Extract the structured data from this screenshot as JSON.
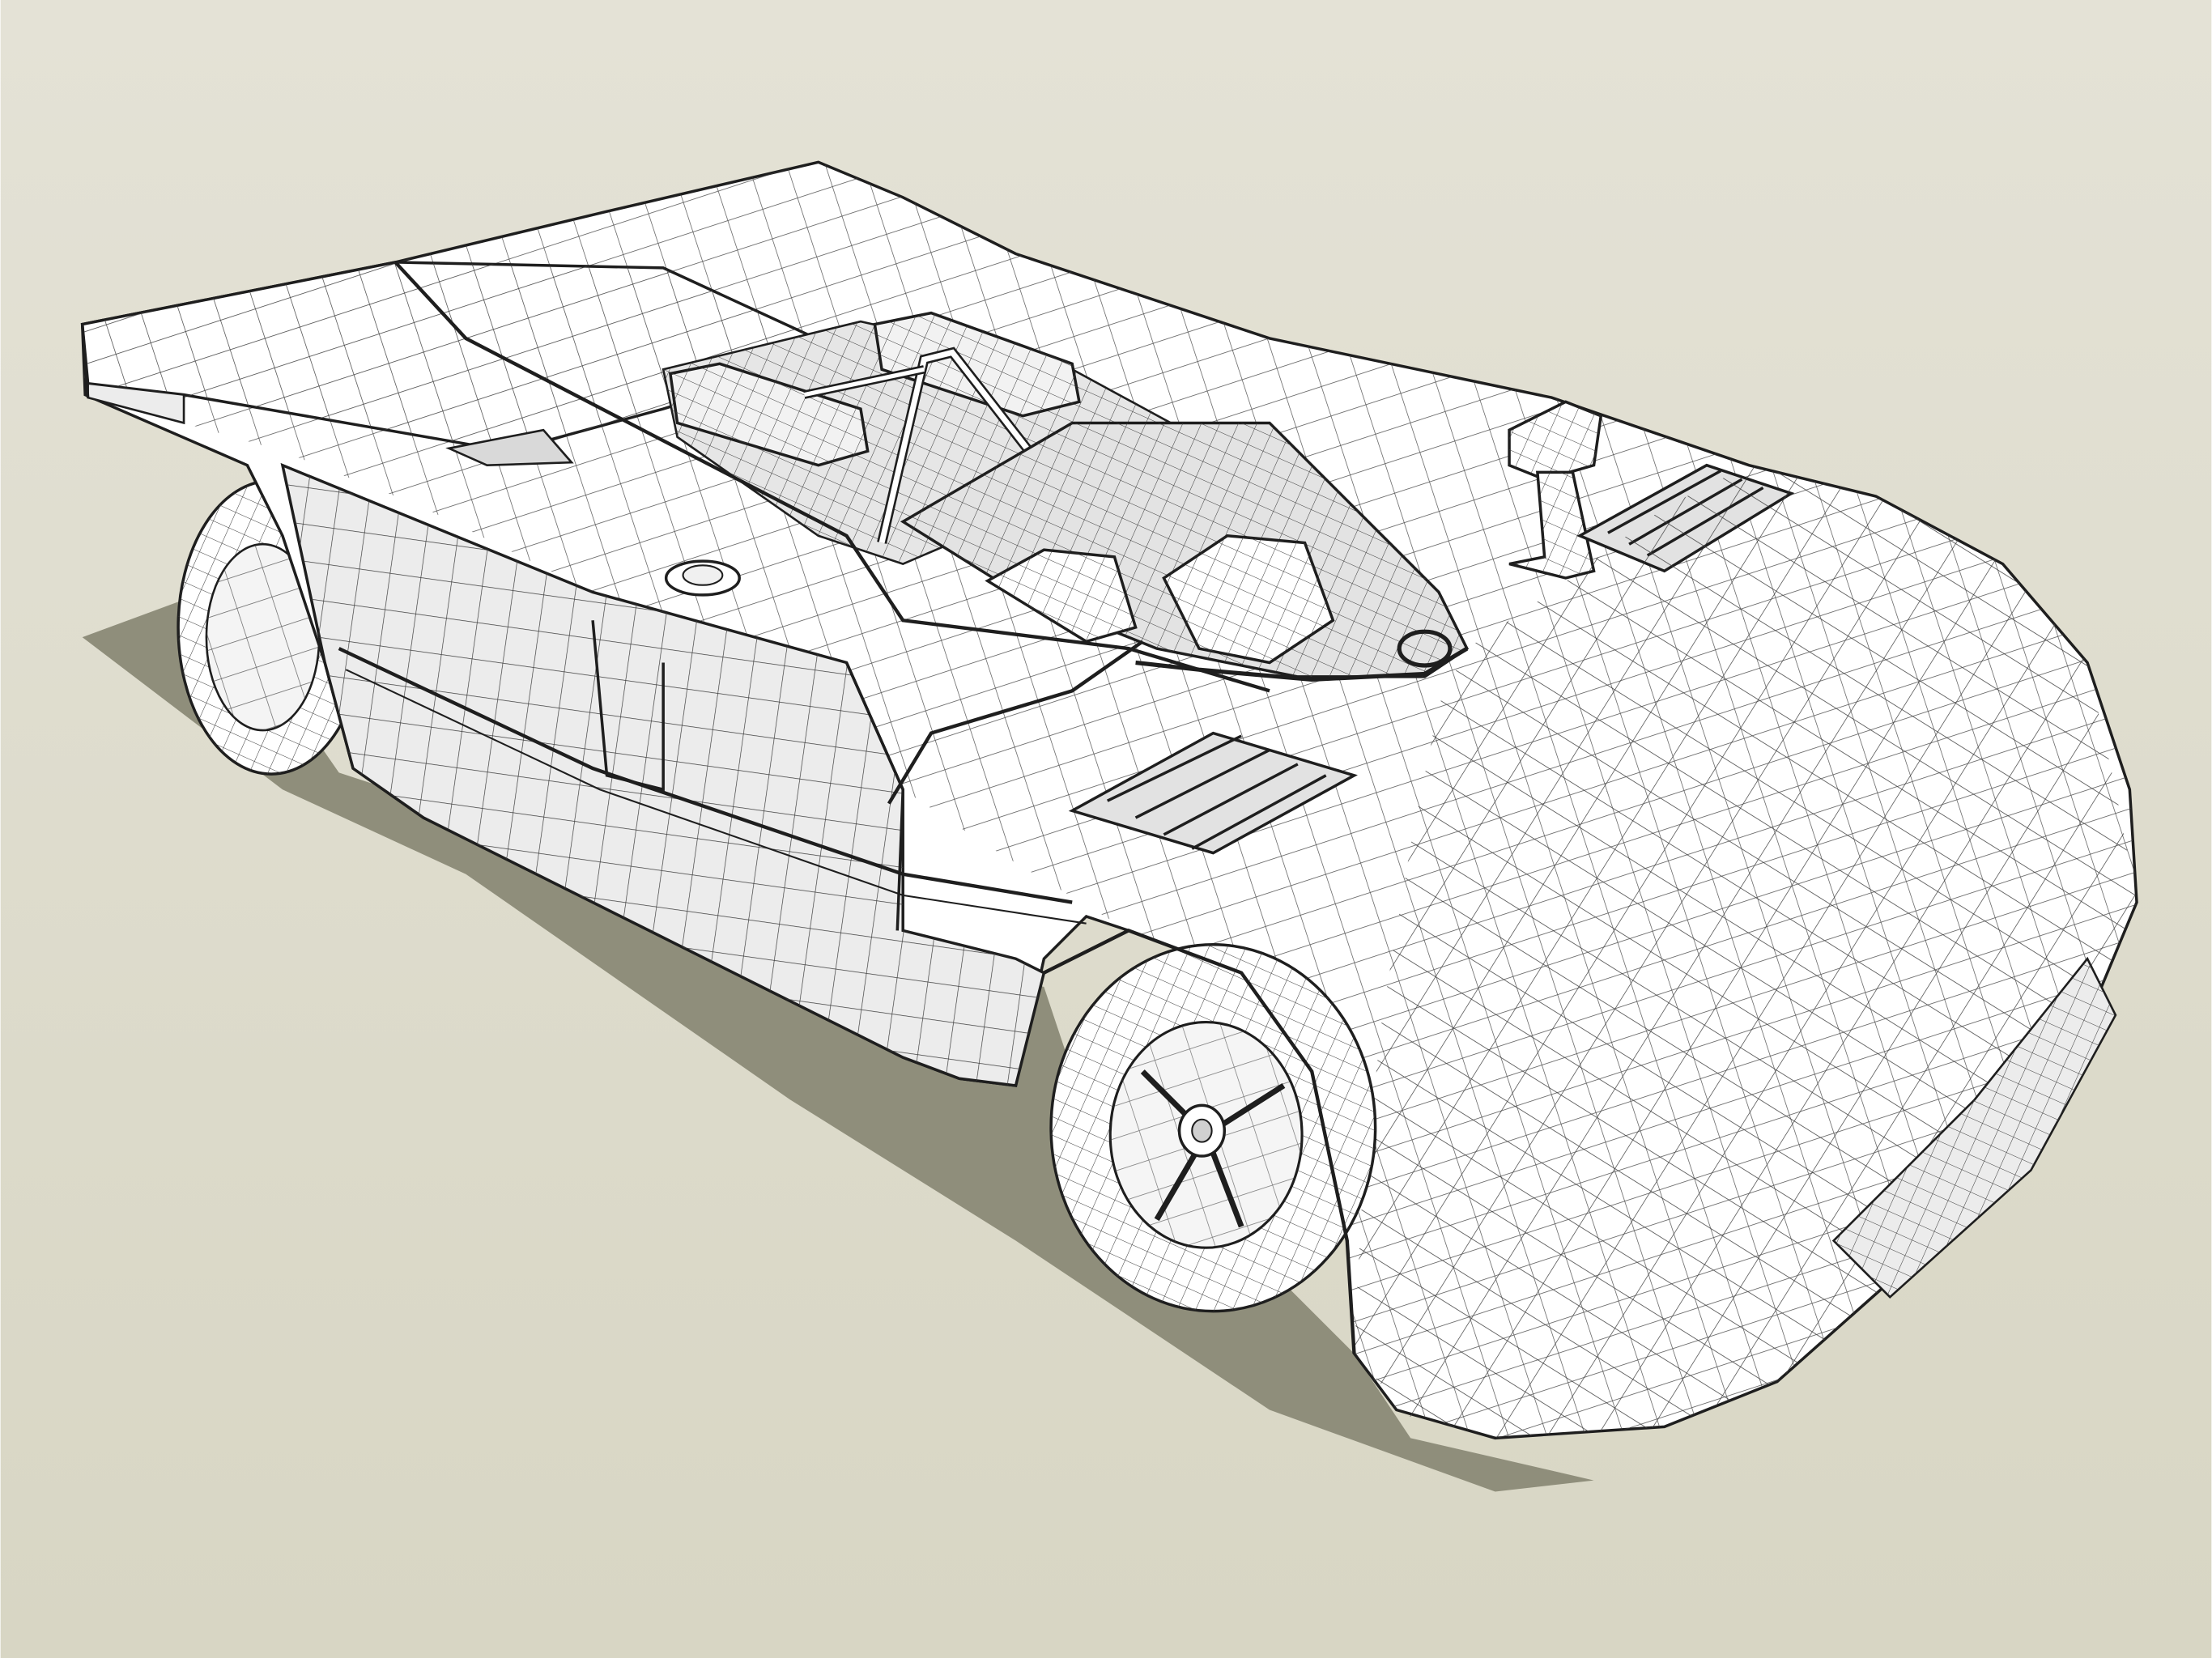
{
  "scene": {
    "background_top": "#e4e2d6",
    "background_bottom": "#d8d6c4",
    "shadow": "#8f8e7b",
    "body_fill": "#ffffff",
    "body_shade": "#ececec",
    "deep_shade": "#d9d9d9",
    "wire": "#1e1e1e",
    "grid": "#3c3c3c"
  },
  "model": {
    "parts": [
      "body",
      "rear-wing",
      "rear-wheel",
      "front-wheel",
      "cockpit",
      "engine",
      "roll-bar",
      "fuel-filler-cap",
      "mirror",
      "front-hood-vents",
      "side-vents",
      "nose",
      "shadow"
    ]
  }
}
